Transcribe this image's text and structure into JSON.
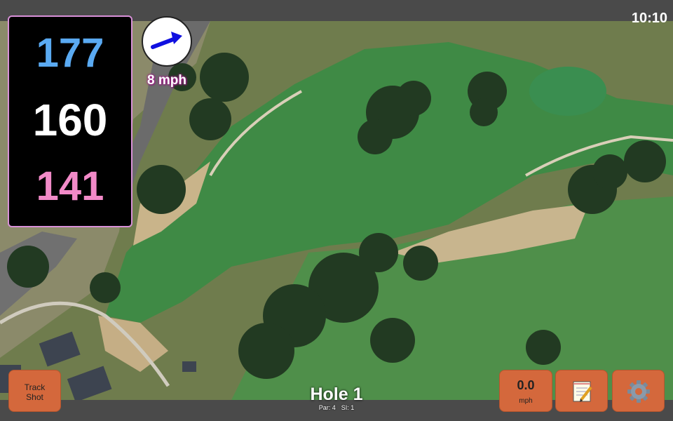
{
  "status": {
    "time": "10:10"
  },
  "distances": {
    "back": "177",
    "middle": "160",
    "front": "141"
  },
  "wind": {
    "speed_text": "8 mph",
    "direction_icon": "wind-direction-arrow"
  },
  "buttons": {
    "track_shot_line1": "Track",
    "track_shot_line2": "Shot",
    "speed_value": "0.0",
    "speed_unit": "mph",
    "notes_icon": "notepad-icon",
    "settings_icon": "gear-icon"
  },
  "hole": {
    "title": "Hole 1",
    "par": "Par: 4",
    "stroke_index": "SI: 1"
  },
  "colors": {
    "back": "#5aaaf2",
    "middle": "#ffffff",
    "front": "#f28ac8",
    "button": "#d4683c",
    "panel_border": "#d890d8"
  }
}
